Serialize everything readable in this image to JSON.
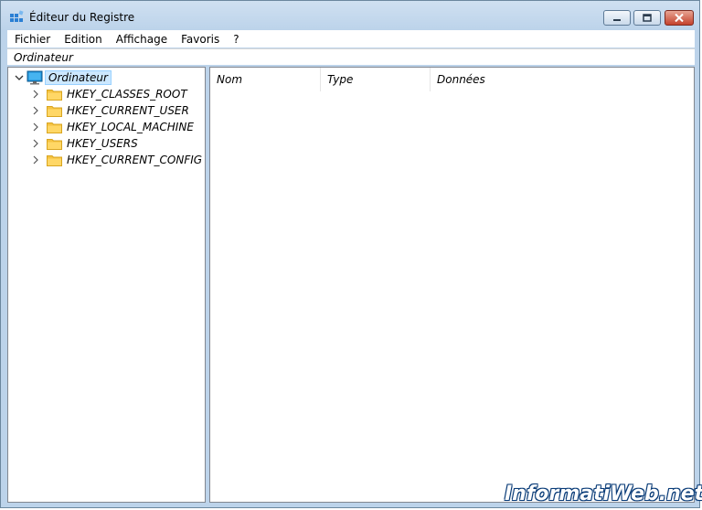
{
  "window": {
    "title": "Éditeur du Registre",
    "icon": "registry-editor-icon"
  },
  "title_controls": {
    "minimize": "minimize-icon",
    "maximize": "maximize-icon",
    "close": "close-icon"
  },
  "menu": {
    "items": [
      "Fichier",
      "Edition",
      "Affichage",
      "Favoris",
      "?"
    ]
  },
  "address_bar": {
    "path": "Ordinateur"
  },
  "tree": {
    "root": {
      "label": "Ordinateur",
      "icon": "computer-icon",
      "expanded": true,
      "selected": true
    },
    "keys": [
      {
        "label": "HKEY_CLASSES_ROOT"
      },
      {
        "label": "HKEY_CURRENT_USER"
      },
      {
        "label": "HKEY_LOCAL_MACHINE"
      },
      {
        "label": "HKEY_USERS"
      },
      {
        "label": "HKEY_CURRENT_CONFIG"
      }
    ]
  },
  "list": {
    "columns": [
      "Nom",
      "Type",
      "Données"
    ],
    "rows": []
  },
  "watermark": {
    "text": "InformatiWeb.net"
  },
  "colors": {
    "frame": "#bcd3ea",
    "close_button": "#c4422d",
    "selection": "#cce8ff",
    "folder": "#f5c342"
  }
}
